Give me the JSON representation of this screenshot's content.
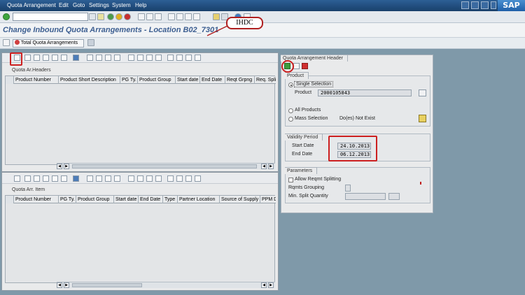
{
  "menu": {
    "items": [
      "Quota Arrangement",
      "Edit",
      "Goto",
      "Settings",
      "System",
      "Help"
    ],
    "logo": "SAP"
  },
  "toolbar": {
    "command_field_value": ""
  },
  "title": {
    "text": "Change Inbound Quota Arrangements - Location B02_7301"
  },
  "callout": {
    "text": "IHDC"
  },
  "app_toolbar": {
    "total_quota_label": "Total Quota Arrangements"
  },
  "headers_panel": {
    "label": "Quota Ar.Headers",
    "columns": [
      "Product Number",
      "Product Short Description",
      "PG Ty.",
      "Product Group",
      "Start date",
      "End Date",
      "Reqt Grpng",
      "Req. Split"
    ]
  },
  "items_panel": {
    "label": "Quota Arr. Item",
    "columns": [
      "Product Number",
      "PG Ty.",
      "Product Group",
      "Start date",
      "End Date",
      "Type",
      "Partner Location",
      "Source of Supply",
      "PPM De"
    ]
  },
  "right_panel": {
    "tab_title": "Quota Arrangement Header",
    "product_group": {
      "title": "Product",
      "single_selection_label": "Single Selection",
      "product_label": "Product",
      "product_value": "2000105843",
      "all_products_label": "All Products",
      "mass_selection_label": "Mass Selection",
      "does_not_exist_label": "Do(es) Not Exist"
    },
    "validity_group": {
      "title": "Validity Period",
      "start_label": "Start Date",
      "start_value": "24.10.2013",
      "end_label": "End Date",
      "end_value": "06.12.2013"
    },
    "parameters_group": {
      "title": "Parameters",
      "allow_split_label": "Allow Reqmt Splitting",
      "grouping_label": "Rqmts Grouping",
      "min_split_label": "Min. Split Quantity"
    }
  },
  "colors": {
    "menubar": "#19406b",
    "title_text": "#3d5f91",
    "highlight": "#cc2020",
    "background": "#7f99a9"
  }
}
